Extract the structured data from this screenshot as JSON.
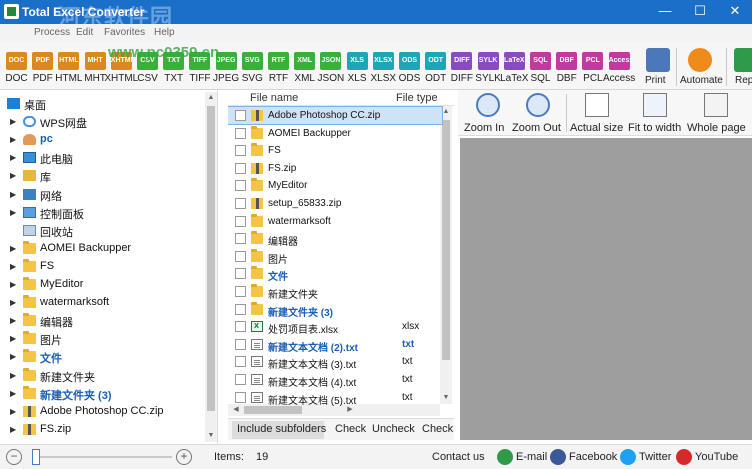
{
  "window": {
    "title": "Total Excel Converter",
    "watermark": "河东软件园",
    "watermark_url": "www.pc0359.cn",
    "minimize": "—",
    "maximize": "☐",
    "close": "✕"
  },
  "menu": [
    "Process",
    "Edit",
    "Favorites",
    "Help"
  ],
  "toolbar": {
    "formats": [
      {
        "chip": "DOC",
        "label": "DOC",
        "color": "#d98a1f"
      },
      {
        "chip": "PDF",
        "label": "PDF",
        "color": "#d98a1f"
      },
      {
        "chip": "HTML",
        "label": "HTML",
        "color": "#d98a1f"
      },
      {
        "chip": "MHT",
        "label": "MHT",
        "color": "#d98a1f"
      },
      {
        "chip": "XHTML",
        "label": "XHTML",
        "color": "#d98a1f"
      },
      {
        "chip": "CSV",
        "label": "CSV",
        "color": "#3cae3c"
      },
      {
        "chip": "TXT",
        "label": "TXT",
        "color": "#3cae3c"
      },
      {
        "chip": "TIFF",
        "label": "TIFF",
        "color": "#3cae3c"
      },
      {
        "chip": "JPEG",
        "label": "JPEG",
        "color": "#3cae3c"
      },
      {
        "chip": "SVG",
        "label": "SVG",
        "color": "#3cae3c"
      },
      {
        "chip": "RTF",
        "label": "RTF",
        "color": "#3cae3c"
      },
      {
        "chip": "XML",
        "label": "XML",
        "color": "#3cae3c"
      },
      {
        "chip": "JSON",
        "label": "JSON",
        "color": "#3cae3c"
      },
      {
        "chip": "XLS",
        "label": "XLS",
        "color": "#1ca6b8"
      },
      {
        "chip": "XLSX",
        "label": "XLSX",
        "color": "#1ca6b8"
      },
      {
        "chip": "ODS",
        "label": "ODS",
        "color": "#1ca6b8"
      },
      {
        "chip": "ODT",
        "label": "ODT",
        "color": "#1ca6b8"
      },
      {
        "chip": "DIFF",
        "label": "DIFF",
        "color": "#8a4bbf"
      },
      {
        "chip": "SYLK",
        "label": "SYLK",
        "color": "#8a4bbf"
      },
      {
        "chip": "LaTeX",
        "label": "LaTeX",
        "color": "#8a4bbf"
      },
      {
        "chip": "SQL",
        "label": "SQL",
        "color": "#c23aa0"
      },
      {
        "chip": "DBF",
        "label": "DBF",
        "color": "#c23aa0"
      },
      {
        "chip": "PCL",
        "label": "PCL",
        "color": "#c23aa0"
      },
      {
        "chip": "Access",
        "label": "Access",
        "color": "#c23aa0"
      }
    ],
    "print": "Print",
    "automate": "Automate",
    "report": "Rep"
  },
  "tree": [
    {
      "label": "桌面",
      "icon": "desktop-icon",
      "arrow": "",
      "indent": 0
    },
    {
      "label": "WPS网盘",
      "icon": "cloud-icon",
      "arrow": "▶",
      "indent": 1
    },
    {
      "label": "pc",
      "icon": "user-icon",
      "arrow": "▶",
      "indent": 1,
      "bold": true
    },
    {
      "label": "此电脑",
      "icon": "computer-icon",
      "arrow": "▶",
      "indent": 1
    },
    {
      "label": "库",
      "icon": "library-icon",
      "arrow": "▶",
      "indent": 1
    },
    {
      "label": "网络",
      "icon": "network-icon",
      "arrow": "▶",
      "indent": 1
    },
    {
      "label": "控制面板",
      "icon": "control-panel-icon",
      "arrow": "▶",
      "indent": 1
    },
    {
      "label": "回收站",
      "icon": "recycle-bin-icon",
      "arrow": "",
      "indent": 1
    },
    {
      "label": "AOMEI Backupper",
      "icon": "folder-icon",
      "arrow": "▶",
      "indent": 1
    },
    {
      "label": "FS",
      "icon": "folder-icon",
      "arrow": "▶",
      "indent": 1
    },
    {
      "label": "MyEditor",
      "icon": "folder-icon",
      "arrow": "▶",
      "indent": 1
    },
    {
      "label": "watermarksoft",
      "icon": "folder-icon",
      "arrow": "▶",
      "indent": 1
    },
    {
      "label": "编辑器",
      "icon": "folder-icon",
      "arrow": "▶",
      "indent": 1
    },
    {
      "label": "图片",
      "icon": "folder-icon",
      "arrow": "▶",
      "indent": 1
    },
    {
      "label": "文件",
      "icon": "folder-icon",
      "arrow": "▶",
      "indent": 1,
      "blue": true
    },
    {
      "label": "新建文件夹",
      "icon": "folder-icon",
      "arrow": "▶",
      "indent": 1
    },
    {
      "label": "新建文件夹 (3)",
      "icon": "folder-icon",
      "arrow": "▶",
      "indent": 1,
      "blue": true
    },
    {
      "label": "Adobe Photoshop CC.zip",
      "icon": "zip-icon",
      "arrow": "▶",
      "indent": 1
    },
    {
      "label": "FS.zip",
      "icon": "zip-icon",
      "arrow": "▶",
      "indent": 1
    }
  ],
  "filelist": {
    "col_name": "File name",
    "col_type": "File type",
    "rows": [
      {
        "name": "Adobe Photoshop CC.zip",
        "type": "",
        "icon": "zip",
        "selected": true
      },
      {
        "name": "AOMEI Backupper",
        "type": "",
        "icon": "folder"
      },
      {
        "name": "FS",
        "type": "",
        "icon": "folder"
      },
      {
        "name": "FS.zip",
        "type": "",
        "icon": "zip"
      },
      {
        "name": "MyEditor",
        "type": "",
        "icon": "folder"
      },
      {
        "name": "setup_65833.zip",
        "type": "",
        "icon": "zip"
      },
      {
        "name": "watermarksoft",
        "type": "",
        "icon": "folder"
      },
      {
        "name": "编辑器",
        "type": "",
        "icon": "folder"
      },
      {
        "name": "图片",
        "type": "",
        "icon": "folder"
      },
      {
        "name": "文件",
        "type": "",
        "icon": "folder",
        "blue": true
      },
      {
        "name": "新建文件夹",
        "type": "",
        "icon": "folder"
      },
      {
        "name": "新建文件夹 (3)",
        "type": "",
        "icon": "folder",
        "blue": true
      },
      {
        "name": "处罚项目表.xlsx",
        "type": "xlsx",
        "icon": "xls"
      },
      {
        "name": "新建文本文档 (2).txt",
        "type": "txt",
        "icon": "doc",
        "blue": true
      },
      {
        "name": "新建文本文档 (3).txt",
        "type": "txt",
        "icon": "doc"
      },
      {
        "name": "新建文本文档 (4).txt",
        "type": "txt",
        "icon": "doc"
      },
      {
        "name": "新建文本文档 (5).txt",
        "type": "txt",
        "icon": "doc"
      }
    ],
    "include_subfolders": "Include subfolders",
    "check": "Check",
    "uncheck": "Uncheck",
    "check2": "Check"
  },
  "preview": {
    "zoom_in": "Zoom In",
    "zoom_out": "Zoom Out",
    "actual_size": "Actual size",
    "fit_to_width": "Fit to width",
    "whole_page": "Whole page"
  },
  "status": {
    "items_label": "Items:",
    "items_count": "19",
    "contact": "Contact us",
    "email": "E-mail",
    "facebook": "Facebook",
    "twitter": "Twitter",
    "youtube": "YouTube"
  }
}
